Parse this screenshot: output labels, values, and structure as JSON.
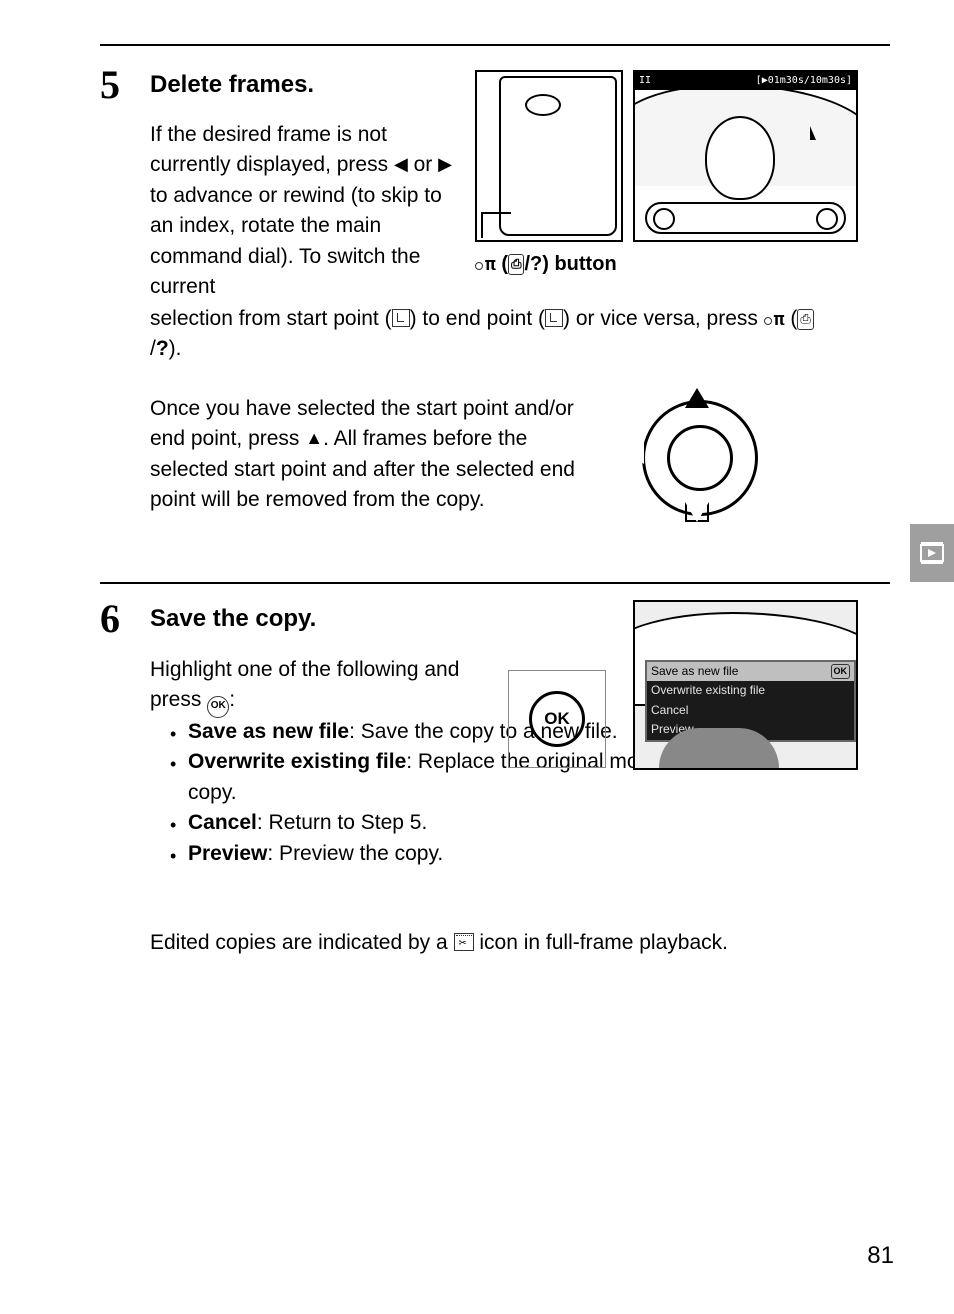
{
  "page_number": "81",
  "step5": {
    "number": "5",
    "heading": "Delete frames.",
    "p1a": "If the desired frame is not currently displayed, press ",
    "p1b": " or ",
    "p1c": " to advance or rewind (to skip to an index, rotate the main command dial).  To switch the current",
    "p1d": "selection from start point (",
    "p1e": ") to end point (",
    "p1f": ") or vice versa, press ",
    "p1g": " (",
    "p1h": "/",
    "p1i": ").",
    "p2a": "Once you have selected the start point and/or end point, press ",
    "p2b": ".  All frames before the selected start point and after the selected end point will be removed from the copy.",
    "caption_a": " (",
    "caption_b": "/",
    "caption_c": ") button",
    "lcd_bar_left": "II",
    "lcd_bar_right": "[▶01m30s/10m30s]"
  },
  "step6": {
    "number": "6",
    "heading": "Save the copy.",
    "p1a": "Highlight one of the following and press ",
    "p1b": ":",
    "b1_label": "Save as new file",
    "b1_text": ": Save the copy to a new file.",
    "b2_label": "Overwrite existing file",
    "b2_text": ": Replace the original movie file with the edited copy.",
    "b3_label": "Cancel",
    "b3_text": ": Return to Step 5.",
    "b4_label": "Preview",
    "b4_text": ": Preview the copy.",
    "p2a": "Edited copies are indicated by a ",
    "p2b": " icon in full-frame playback.",
    "ok_label": "OK",
    "menu_sel": "Save as new file",
    "menu_ok": "OK",
    "menu_o2": "Overwrite existing file",
    "menu_o3": "Cancel",
    "menu_o4": "Preview"
  },
  "icons": {
    "left": "◀",
    "right": "▶",
    "up": "▲",
    "key": "O",
    "qmark": "?"
  }
}
